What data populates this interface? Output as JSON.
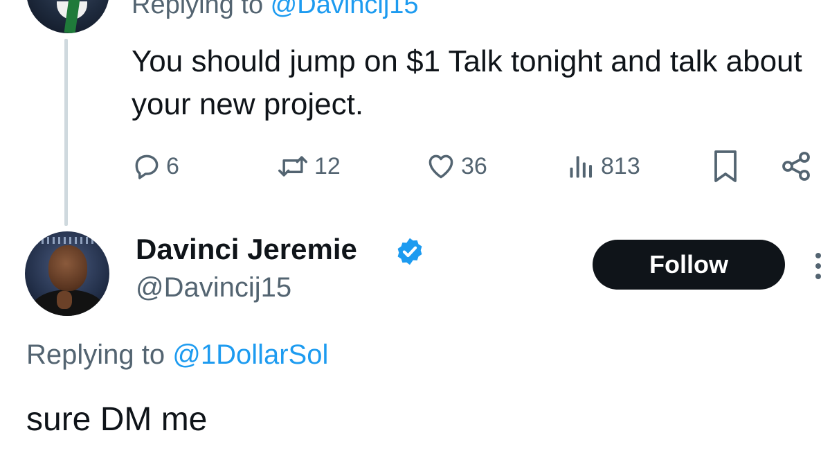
{
  "parent_tweet": {
    "replying_prefix": "Replying to ",
    "replying_mention": "@Davincij15",
    "text": "You should jump on $1 Talk tonight and talk about your new project.",
    "actions": {
      "replies": "6",
      "reposts": "12",
      "likes": "36",
      "views": "813"
    },
    "icons": [
      "reply-icon",
      "repost-icon",
      "like-icon",
      "views-icon",
      "bookmark-icon",
      "share-icon"
    ]
  },
  "reply_tweet": {
    "display_name": "Davinci Jeremie",
    "handle": "@Davincij15",
    "verified_icon": "verified-badge-icon",
    "follow_label": "Follow",
    "replying_prefix": "Replying to ",
    "replying_mention": "@1DollarSol",
    "text": "sure DM me"
  },
  "colors": {
    "text_primary": "#0f1419",
    "text_secondary": "#536471",
    "accent": "#1d9bf0",
    "follow_bg": "#0f1419",
    "thread_line": "#cfd9de"
  }
}
